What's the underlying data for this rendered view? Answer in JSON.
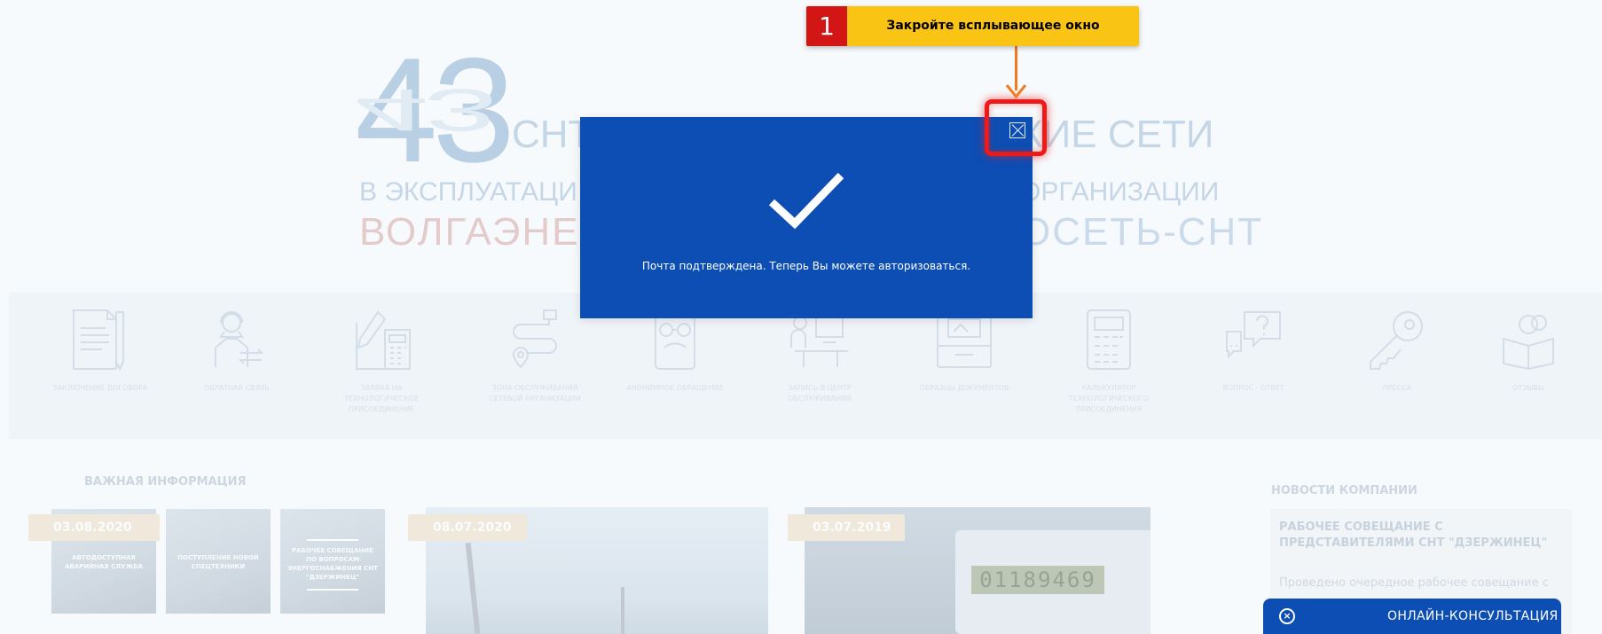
{
  "hero": {
    "number": "43",
    "line1_left": "СНТ",
    "line1_right": "КИЕ СЕТИ",
    "line2_left": "В ЭКСПЛУАТАЦИ",
    "line2_right": "ОРГАНИЗАЦИИ",
    "line3_left": "ВОЛГАЭНЕР",
    "line3_right": "ОСЕТЬ-СНТ"
  },
  "services": [
    {
      "label": "ЗАКЛЮЧЕНИЕ ДОГОВОРА",
      "icon": "contract-icon"
    },
    {
      "label": "ОБРАТНАЯ СВЯЗЬ",
      "icon": "operator-icon"
    },
    {
      "label": "ЗАЯВКА НА ТЕХНОЛОГИЧЕСКОЕ ПРИСОЕДИНЕНИЕ",
      "icon": "application-icon"
    },
    {
      "label": "ЗОНА ОБСЛУЖИВАНИЯ СЕТЕВОЙ ОРГАНИЗАЦИИ",
      "icon": "route-icon"
    },
    {
      "label": "АНОНИМНОЕ ОБРАЩЕНИЕ",
      "icon": "anonymous-icon"
    },
    {
      "label": "ЗАПИСЬ В ЦЕНТР ОБСЛУЖИВАНИЯ",
      "icon": "service-center-icon"
    },
    {
      "label": "ОБРАЗЦЫ ДОКУМЕНТОВ",
      "icon": "documents-icon"
    },
    {
      "label": "КАЛЬКУЛЯТОР ТЕХНОЛОГИЧЕСКОГО ПРИСОЕДИНЕНИЯ",
      "icon": "calculator-icon"
    },
    {
      "label": "ВОПРОС - ОТВЕТ",
      "icon": "question-icon"
    },
    {
      "label": "ПРЕССА",
      "icon": "key-icon"
    },
    {
      "label": "ОТЗЫВЫ",
      "icon": "reviews-icon"
    }
  ],
  "important": {
    "title": "ВАЖНАЯ ИНФОРМАЦИЯ",
    "date": "03.08.2020",
    "thumbs": [
      "АВТОДОСТУПНАЯ АВАРИЙНАЯ СЛУЖБА",
      "ПОСТУПЛЕНИЕ НОВОЙ СПЕЦТЕХНИКИ",
      "РАБОЧЕЕ СОВЕЩАНИЕ ПО ВОПРОСАМ ЭНЕРГОСНАБЖЕНИЯ СНТ \"ДЗЕРЖИНЕЦ\""
    ]
  },
  "news_photos": [
    {
      "date": "08.07.2020"
    },
    {
      "date": "03.07.2019",
      "meter_reading": "01189469"
    }
  ],
  "company_news": {
    "title": "НОВОСТИ КОМПАНИИ",
    "card_title": "РАБОЧЕЕ СОВЕЩАНИЕ С ПРЕДСТАВИТЕЛЯМИ СНТ \"ДЗЕРЖИНЕЦ\"",
    "card_text": "Проведено очередное рабочее совещание с"
  },
  "modal": {
    "message": "Почта подтверждена. Теперь Вы можете авторизоваться."
  },
  "annotation": {
    "step": "1",
    "text": "Закройте всплывающее окно"
  },
  "consult": {
    "icon_glyph": "×",
    "label": "ОНЛАЙН-КОНСУЛЬТАЦИЯ"
  },
  "colors": {
    "modal_bg": "#0c4eb4",
    "highlight": "#ee1a1a",
    "tip_bg": "#fac414",
    "tip_num_bg": "#d21515",
    "arrow": "#f47a1f"
  }
}
